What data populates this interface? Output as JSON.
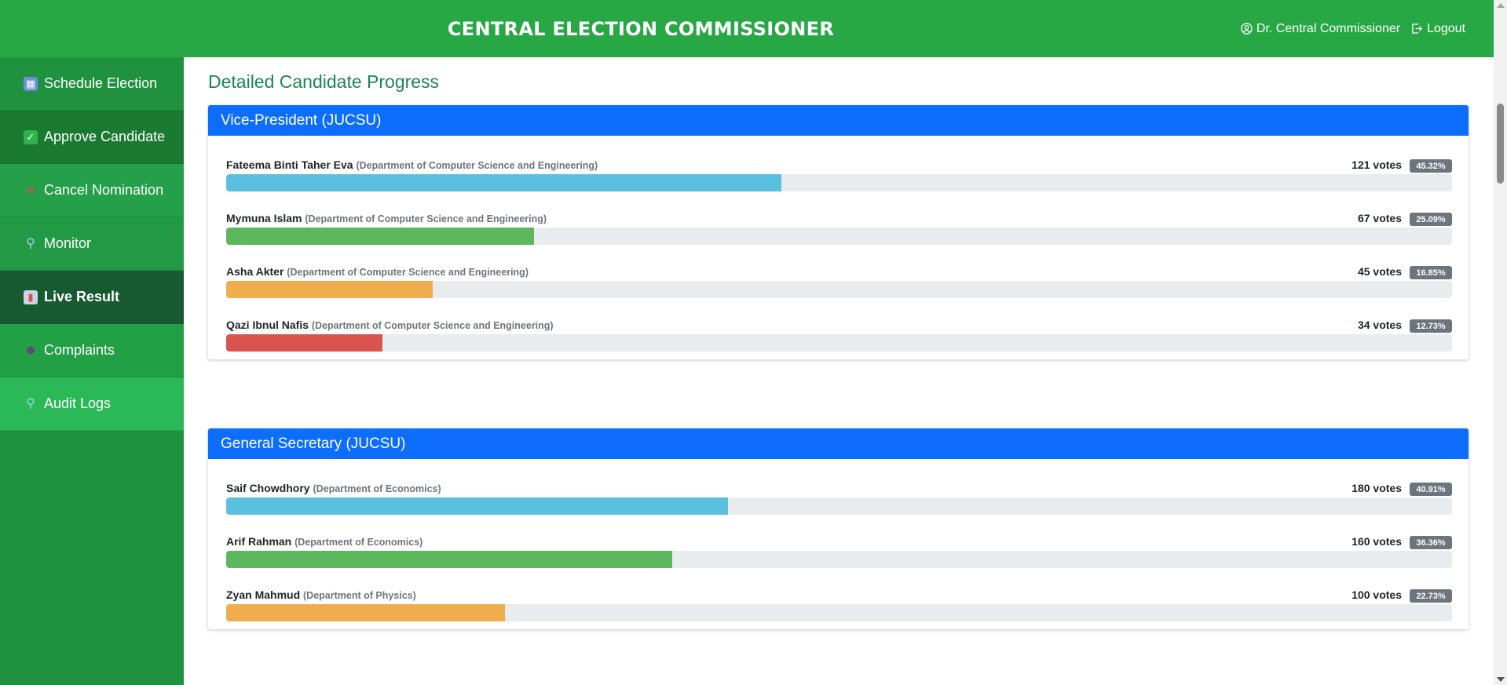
{
  "header": {
    "title": "CENTRAL ELECTION COMMISSIONER",
    "user_name": "Dr. Central Commissioner",
    "logout_label": "Logout"
  },
  "sidebar": {
    "items": [
      {
        "label": "Schedule Election",
        "icon": "calendar-icon",
        "bg": "#20913f",
        "icon_bg": "#6f8fd8",
        "icon_glyph": "▦"
      },
      {
        "label": "Approve Candidate",
        "icon": "check-box-icon",
        "bg": "#1b7a31",
        "icon_bg": "#2fb34a",
        "icon_glyph": "✓"
      },
      {
        "label": "Cancel Nomination",
        "icon": "cross-mark-icon",
        "bg": "#23a049",
        "icon_bg": "transparent",
        "icon_glyph": "✕"
      },
      {
        "label": "Monitor",
        "icon": "magnifier-icon",
        "bg": "#229a45",
        "icon_bg": "transparent",
        "icon_glyph": "⚲"
      },
      {
        "label": "Live Result",
        "icon": "bar-chart-icon",
        "bg": "#175930",
        "icon_bg": "#c9d6ea",
        "icon_glyph": "▮"
      },
      {
        "label": "Complaints",
        "icon": "speaking-head-icon",
        "bg": "#22a046",
        "icon_bg": "transparent",
        "icon_glyph": "☻"
      },
      {
        "label": "Audit Logs",
        "icon": "magnifier-right-icon",
        "bg": "#2bb856",
        "icon_bg": "transparent",
        "icon_glyph": "⚲"
      }
    ],
    "active_index": 4
  },
  "main": {
    "section_title": "Detailed Candidate Progress",
    "positions": [
      {
        "title": "Vice-President (JUCSU)",
        "candidates": [
          {
            "name": "Fateema Binti Taher Eva",
            "department": "(Department of Computer Science and Engineering)",
            "votes": "121 votes",
            "percent_label": "45.32%",
            "percent": 45.32,
            "color": "#5bc0de"
          },
          {
            "name": "Mymuna Islam",
            "department": "(Department of Computer Science and Engineering)",
            "votes": "67 votes",
            "percent_label": "25.09%",
            "percent": 25.09,
            "color": "#5cb85c"
          },
          {
            "name": "Asha Akter",
            "department": "(Department of Computer Science and Engineering)",
            "votes": "45 votes",
            "percent_label": "16.85%",
            "percent": 16.85,
            "color": "#f0ad4e"
          },
          {
            "name": "Qazi Ibnul Nafis",
            "department": "(Department of Computer Science and Engineering)",
            "votes": "34 votes",
            "percent_label": "12.73%",
            "percent": 12.73,
            "color": "#d9534f"
          }
        ]
      },
      {
        "title": "General Secretary (JUCSU)",
        "candidates": [
          {
            "name": "Saif Chowdhory",
            "department": "(Department of Economics)",
            "votes": "180 votes",
            "percent_label": "40.91%",
            "percent": 40.91,
            "color": "#5bc0de"
          },
          {
            "name": "Arif Rahman",
            "department": "(Department of Economics)",
            "votes": "160 votes",
            "percent_label": "36.36%",
            "percent": 36.36,
            "color": "#5cb85c"
          },
          {
            "name": "Zyan Mahmud",
            "department": "(Department of Physics)",
            "votes": "100 votes",
            "percent_label": "22.73%",
            "percent": 22.73,
            "color": "#f0ad4e"
          }
        ]
      }
    ]
  }
}
